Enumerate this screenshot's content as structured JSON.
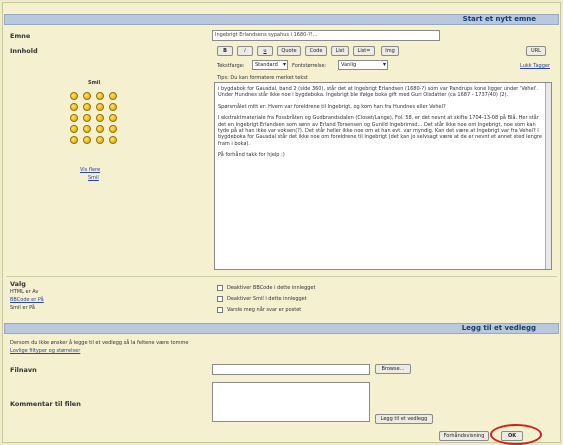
{
  "header": {
    "title": "Start et nytt emne"
  },
  "emne": {
    "label": "Emne",
    "value": "Ingebrigt Erlandsens sypahus i 1680-?!..."
  },
  "innhold": {
    "label": "Innhold"
  },
  "toolbar": {
    "b": "B",
    "i": "i",
    "u": "u",
    "quote": "Quote",
    "code": "Code",
    "list": "List",
    "list_eq": "List=",
    "img": "Img",
    "url": "URL",
    "lukk_tagger": "Lukk Tagger",
    "skriftfarge_label": "Tekstfarge:",
    "skriftfarge_value": "Standard",
    "skriftstorrelse_label": "Fontstørrelse:",
    "skriftstorrelse_value": "Vanlig",
    "tips": "Tips: Du kan formatere merket tekst"
  },
  "smilies": {
    "title": "Smil",
    "more_link_1": "Vis flere",
    "more_link_2": "Smil"
  },
  "message": {
    "p1": "i bygdabok for Gausdal, band 2 (side 360), står det at Ingebrigt Erlandsen (1680-?) som var Pandrups kone ligger under 'Vehel'. Under Hundnes står ikke noe i bygdeboka. Ingebrigt ble ifølge boka gift med Guri Olsdatter (ca 1687 - 1737/40) (2).",
    "p2": "Spørsmålet mitt er: Hvem var foreldrene til Ingebrigt, og kom han fra Hundnes eller Vehel?",
    "p3": "I ekstraktmateriale fra Fossbråten og Gudbrandsdalen (Closet/Lange), Fol. 58, er det nevnt at skifte 1704-13-08 på Blå. Her står det en Ingebrigt Erlandsen som sønn av Erland Torsensen og Gunild Ingebrimsd... Det står ikke noe om Ingebrigt, noe som kan tyde på at han ikke var voksen(?). Det står heller ikke noe om at han evt. var myndig. Kan det være at Ingebrigt var fra Vehel? I bygdeboka for Gausdal står det ikke noe om foreldrene til Ingebrigt (det kan jo selvsagt være at de er nevnt et annet sted lengre fram i boka).",
    "p4": "På forhånd takk for hjelp :)"
  },
  "valg": {
    "label": "Valg",
    "html_info": "HTML er Av",
    "bbcode_info": "BBCode er På",
    "smil_info": "Smil er På",
    "opt1": "Deaktiver BBCode i dette innlegget",
    "opt2": "Deaktiver Smil i dette innlegget",
    "opt3": "Varsle meg når svar er postet"
  },
  "vedlegg": {
    "header": "Legg til et vedlegg",
    "info": "Dersom du ikke ønsker å legge til et vedlegg så la feltene være tomme",
    "info_link": "Lovlige filtyper og størrelser",
    "filnavn_label": "Filnavn",
    "browse": "Browse...",
    "kommentar_label": "Kommentar til filen",
    "add_button": "Legg til et vedlegg"
  },
  "footer": {
    "preview": "Forhåndsvisning",
    "ok": "OK"
  },
  "colors": {
    "header_bg": "#b9c8dc",
    "page_bg": "#f4f0d0",
    "highlight": "#d4201c"
  }
}
